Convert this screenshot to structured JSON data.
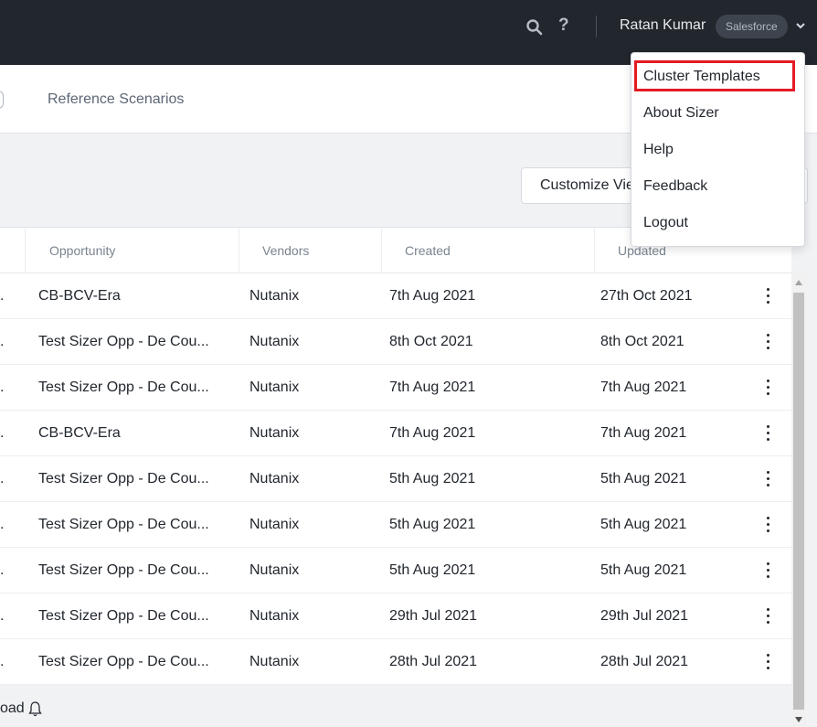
{
  "header": {
    "user_name": "Ratan Kumar",
    "badge": "Salesforce",
    "help_label": "?"
  },
  "nav": {
    "tab_reference": "Reference Scenarios"
  },
  "toolbar": {
    "customize_label": "Customize View"
  },
  "table": {
    "columns": [
      "Opportunity",
      "Vendors",
      "Created",
      "Updated"
    ],
    "rows": [
      {
        "lead": ".",
        "opportunity": "CB-BCV-Era",
        "vendor": "Nutanix",
        "created": "7th Aug 2021",
        "updated": "27th Oct 2021"
      },
      {
        "lead": ".",
        "opportunity": "Test Sizer Opp - De Cou...",
        "vendor": "Nutanix",
        "created": "8th Oct 2021",
        "updated": "8th Oct 2021"
      },
      {
        "lead": ".",
        "opportunity": "Test Sizer Opp - De Cou...",
        "vendor": "Nutanix",
        "created": "7th Aug 2021",
        "updated": "7th Aug 2021"
      },
      {
        "lead": ".",
        "opportunity": "CB-BCV-Era",
        "vendor": "Nutanix",
        "created": "7th Aug 2021",
        "updated": "7th Aug 2021"
      },
      {
        "lead": ".",
        "opportunity": "Test Sizer Opp - De Cou...",
        "vendor": "Nutanix",
        "created": "5th Aug 2021",
        "updated": "5th Aug 2021"
      },
      {
        "lead": ".",
        "opportunity": "Test Sizer Opp - De Cou...",
        "vendor": "Nutanix",
        "created": "5th Aug 2021",
        "updated": "5th Aug 2021"
      },
      {
        "lead": ".",
        "opportunity": "Test Sizer Opp - De Cou...",
        "vendor": "Nutanix",
        "created": "5th Aug 2021",
        "updated": "5th Aug 2021"
      },
      {
        "lead": ".",
        "opportunity": "Test Sizer Opp - De Cou...",
        "vendor": "Nutanix",
        "created": "29th Jul 2021",
        "updated": "29th Jul 2021"
      },
      {
        "lead": ".",
        "opportunity": "Test Sizer Opp - De Cou...",
        "vendor": "Nutanix",
        "created": "28th Jul 2021",
        "updated": "28th Jul 2021"
      }
    ]
  },
  "footer": {
    "text": "oad"
  },
  "user_menu": {
    "items": [
      "Cluster Templates",
      "About Sizer",
      "Help",
      "Feedback",
      "Logout"
    ],
    "highlighted": "Cluster Templates"
  },
  "colors": {
    "topbar": "#22272e",
    "highlight": "#e41b23"
  }
}
